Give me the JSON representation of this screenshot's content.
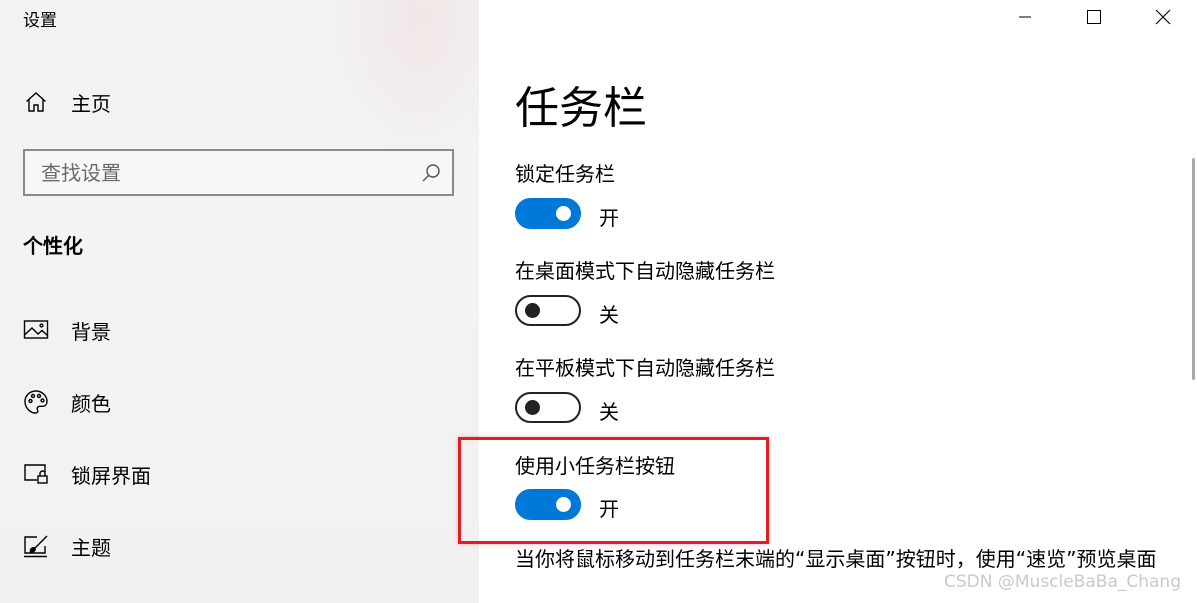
{
  "app": {
    "title": "设置"
  },
  "window_controls": {
    "minimize": "minimize-icon",
    "maximize": "maximize-icon",
    "close": "close-icon"
  },
  "sidebar": {
    "home": {
      "label": "主页",
      "icon": "home-icon"
    },
    "search": {
      "placeholder": "查找设置",
      "value": "",
      "icon": "search-icon"
    },
    "section_header": "个性化",
    "items": [
      {
        "label": "背景",
        "icon": "picture-icon"
      },
      {
        "label": "颜色",
        "icon": "palette-icon"
      },
      {
        "label": "锁屏界面",
        "icon": "lock-screen-icon"
      },
      {
        "label": "主题",
        "icon": "theme-brush-icon"
      }
    ]
  },
  "main": {
    "title": "任务栏",
    "settings": [
      {
        "label": "锁定任务栏",
        "on": true,
        "state_text": "开"
      },
      {
        "label": "在桌面模式下自动隐藏任务栏",
        "on": false,
        "state_text": "关"
      },
      {
        "label": "在平板模式下自动隐藏任务栏",
        "on": false,
        "state_text": "关"
      },
      {
        "label": "使用小任务栏按钮",
        "on": true,
        "state_text": "开"
      }
    ],
    "description": "当你将鼠标移动到任务栏末端的“显示桌面”按钮时，使用“速览”预览桌面"
  },
  "colors": {
    "accent": "#0078d7",
    "highlight": "#e02020"
  },
  "watermark": "CSDN @MuscleBaBa_Chang"
}
